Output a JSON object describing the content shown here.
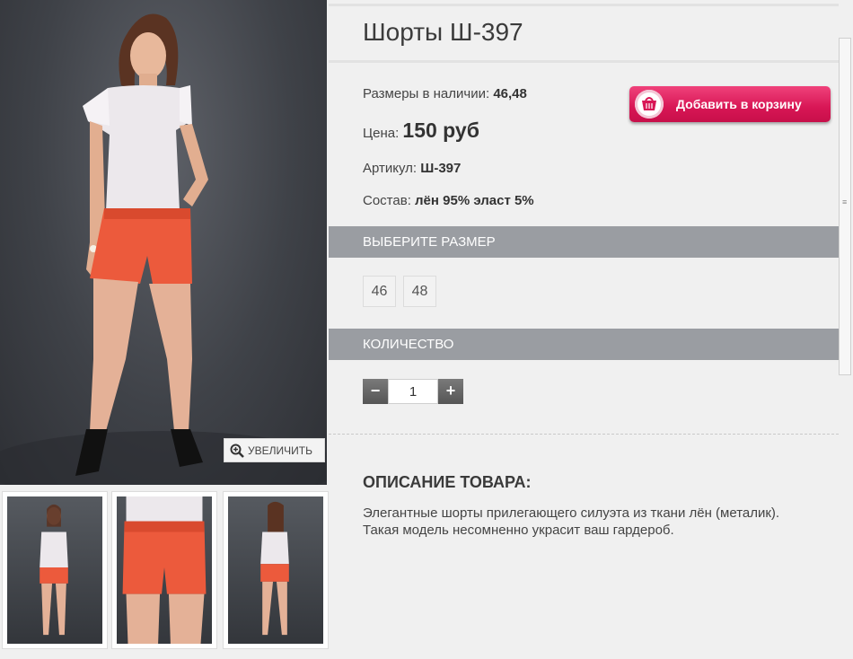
{
  "product": {
    "title": "Шорты Ш-397",
    "sizes_label": "Размеры в наличии:",
    "sizes_value": "46,48",
    "price_label": "Цена:",
    "price_value": "150 руб",
    "sku_label": "Артикул:",
    "sku_value": "Ш-397",
    "composition_label": "Состав:",
    "composition_value": "лён 95% эласт 5%"
  },
  "cart_button": {
    "label": "Добавить в корзину",
    "icon": "basket-icon"
  },
  "zoom_button": {
    "label": "УВЕЛИЧИТЬ",
    "icon": "magnifier-plus-icon"
  },
  "size_section": {
    "header": "ВЫБЕРИТЕ РАЗМЕР",
    "options": [
      "46",
      "48"
    ]
  },
  "quantity_section": {
    "header": "КОЛИЧЕСТВО",
    "minus": "−",
    "plus": "+",
    "value": "1"
  },
  "description": {
    "title": "ОПИСАНИЕ ТОВАРА:",
    "text": "Элегантные шорты прилегающего силуэта из ткани лён (металик). Такая модель несомненно украсит ваш гардероб."
  },
  "colors": {
    "accent": "#d81655",
    "section_bar": "#9a9da2",
    "shorts": "#ec5a3c"
  }
}
